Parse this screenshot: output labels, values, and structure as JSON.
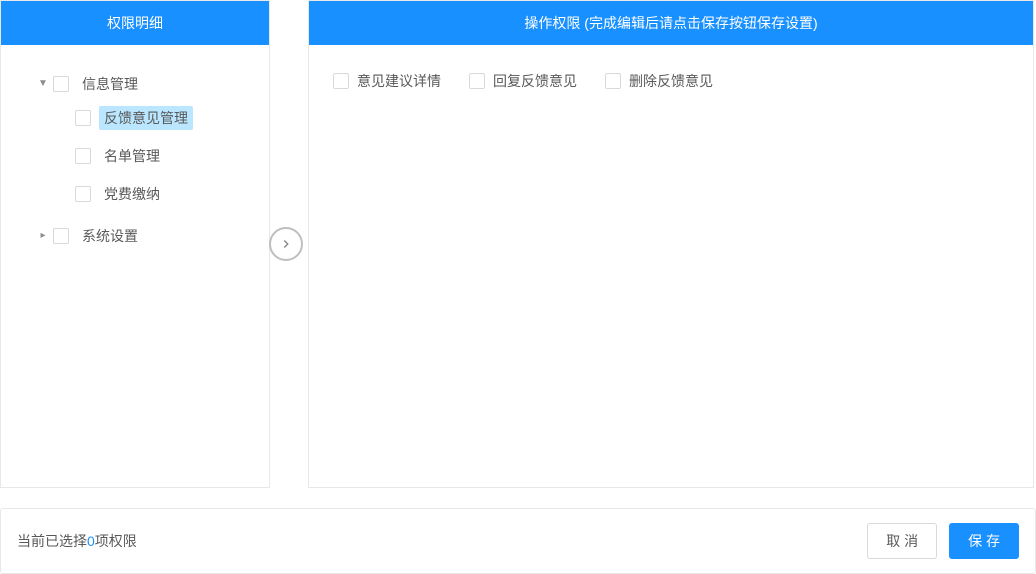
{
  "leftPanel": {
    "title": "权限明细"
  },
  "rightPanel": {
    "title": "操作权限 (完成编辑后请点击保存按钮保存设置)"
  },
  "tree": {
    "node0": {
      "label": "信息管理"
    },
    "node0_children": {
      "c0": {
        "label": "反馈意见管理"
      },
      "c1": {
        "label": "名单管理"
      },
      "c2": {
        "label": "党费缴纳"
      }
    },
    "node1": {
      "label": "系统设置"
    }
  },
  "permissions": {
    "p0": "意见建议详情",
    "p1": "回复反馈意见",
    "p2": "删除反馈意见"
  },
  "footer": {
    "status_prefix": "当前已选择",
    "status_count": "0",
    "status_suffix": "项权限",
    "cancel_label": "取 消",
    "save_label": "保 存"
  }
}
